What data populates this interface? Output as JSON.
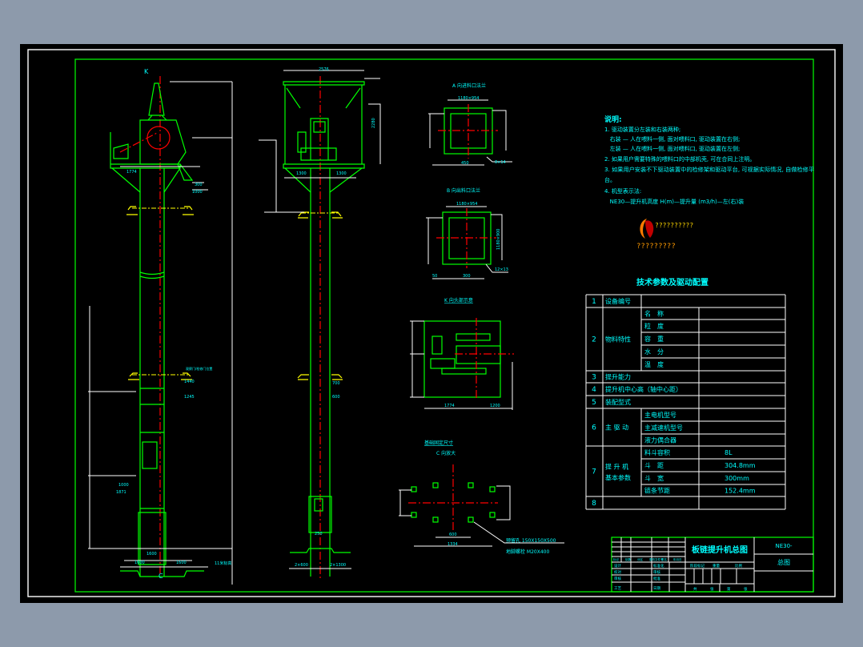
{
  "colors": {
    "background": "#8d9aab",
    "canvas": "#000000",
    "frame": "#00ff00",
    "text": "#00ffff",
    "centerline": "#ff0000",
    "dimension": "#ffffff",
    "foundation": "#ffff00"
  },
  "views": {
    "left": {
      "label_top": "K",
      "label_bottom": "C",
      "dims": [
        "1550",
        "1774",
        "1440",
        "174",
        "300",
        "1000",
        "8800",
        "3000",
        "1440",
        "1245",
        "2440",
        "1550",
        "970",
        "1000",
        "1871",
        "1600",
        "1600"
      ],
      "note": "观察门/检修门位置",
      "side_note": "11米标高"
    },
    "middle": {
      "dims": [
        "2576",
        "2280",
        "1050",
        "1300",
        "1300",
        "1200",
        "700",
        "600",
        "250",
        "2×600",
        "2×1300"
      ]
    },
    "inlet": {
      "title": "A 向进料口法兰",
      "dims": [
        "1180×954",
        "1180×954",
        "300",
        "50",
        "450",
        "8×14"
      ]
    },
    "outlet": {
      "title": "B 向出料口法兰",
      "dims": [
        "1180×954",
        "1180×900",
        "300",
        "50",
        "300",
        "12×13"
      ]
    },
    "head": {
      "title": "K 向头部示意",
      "dims": [
        "1100",
        "1650",
        "1774",
        "1200"
      ]
    },
    "foundation": {
      "title": "基础固定尺寸",
      "subtitle": "C 向放大",
      "dims": [
        "400",
        "600",
        "600",
        "1334"
      ],
      "note1": "预留孔 150X150X500",
      "note2": "地脚螺栓 M20X400"
    }
  },
  "notes": {
    "heading": "说明:",
    "lines": [
      "1. 驱动装置分左装和右装两种;",
      "   右装 — 人在喂料一侧, 面对喂料口, 驱动装置在右侧;",
      "   左装 — 人在喂料一侧, 面对喂料口, 驱动装置在左侧;",
      "2. 如果用户需要特殊的喂料口的中部机壳, 可在合同上注明。",
      "3. 如果用户安装不下驱动装置中的检修架和驱动平台, 可视据实际情况, 自做检修平",
      "台。",
      "4. 机型表示法:",
      "   NE30—提升机高度 H(m)—提升量 (m3/h)—左(右)装"
    ],
    "logo_text": "??????????",
    "logo_sub": "?????????"
  },
  "spec_table": {
    "title": "技术参数及驱动配置",
    "rows": [
      {
        "no": "1",
        "item": "设备编号",
        "sub": []
      },
      {
        "no": "2",
        "item": "物料特性",
        "sub": [
          {
            "k": "名　称",
            "v": ""
          },
          {
            "k": "粒　度",
            "v": ""
          },
          {
            "k": "容　重",
            "v": ""
          },
          {
            "k": "水　分",
            "v": ""
          },
          {
            "k": "温　度",
            "v": ""
          }
        ]
      },
      {
        "no": "3",
        "item": "提升能力",
        "v": ""
      },
      {
        "no": "4",
        "item": "提升机中心高（轴中心距）",
        "v": ""
      },
      {
        "no": "5",
        "item": "装配型式",
        "v": ""
      },
      {
        "no": "6",
        "item": "主 驱 动",
        "sub": [
          {
            "k": "主电机型号",
            "v": ""
          },
          {
            "k": "主减速机型号",
            "v": ""
          },
          {
            "k": "液力偶合器",
            "v": ""
          }
        ]
      },
      {
        "no": "7",
        "item": "提 升 机",
        "item2": "基本参数",
        "sub": [
          {
            "k": "料斗容积",
            "v": "8L"
          },
          {
            "k": "斗　距",
            "v": "304.8mm"
          },
          {
            "k": "斗　宽",
            "v": "300mm"
          },
          {
            "k": "链条节距",
            "v": "152.4mm"
          }
        ]
      },
      {
        "no": "8",
        "item": "",
        "v": ""
      }
    ]
  },
  "title_block": {
    "drawing_title": "板链提升机总图",
    "model": "NE30-",
    "sheet_name": "总图",
    "left_rows": [
      [
        "标记",
        "处数",
        "分区",
        "更改文件号",
        "签名",
        "年月日"
      ],
      [
        "设计",
        "",
        "标准化"
      ],
      [
        "校对",
        "",
        "审核"
      ],
      [
        "审核",
        "",
        "批准"
      ],
      [
        "工艺",
        "",
        "日期"
      ]
    ],
    "mid_labels": [
      "阶段标记",
      "重量",
      "比例"
    ],
    "bottom": [
      "共",
      "张",
      "第",
      "张"
    ]
  }
}
